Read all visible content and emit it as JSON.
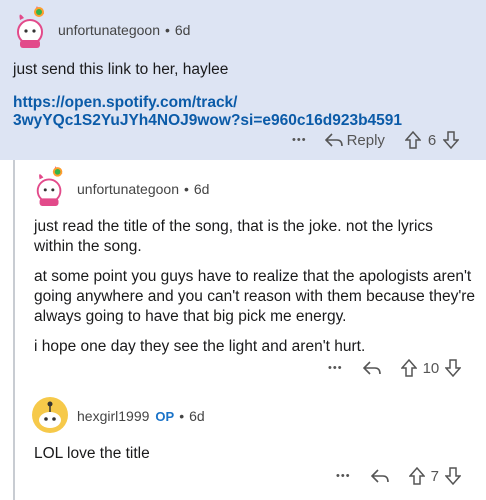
{
  "comments": [
    {
      "username": "unfortunategoon",
      "separator": "•",
      "age": "6d",
      "paragraphs": [
        "just send this link to her, haylee"
      ],
      "link_line1": "https://open.spotify.com/track/",
      "link_line2": "3wyYQc1S2YuJYh4NOJ9wow?si=e960c16d923b4591",
      "more": "•••",
      "reply_label": "Reply",
      "votes": "6"
    },
    {
      "username": "unfortunategoon",
      "separator": "•",
      "age": "6d",
      "paragraphs": [
        "just read the title of the song, that is the joke. not the lyrics within the song.",
        "at some point you guys have to realize that the apologists aren't going anywhere and you can't reason with them because they're always going to have that big pick me energy.",
        "i hope one day they see the light and aren't hurt."
      ],
      "more": "•••",
      "votes": "10"
    },
    {
      "username": "hexgirl1999",
      "op_badge": "OP",
      "separator": "•",
      "age": "6d",
      "paragraphs": [
        "LOL love the title"
      ],
      "more": "•••",
      "votes": "7"
    }
  ],
  "colors": {
    "highlight_bg": "#dde4f3",
    "link": "#0b5ba8",
    "op": "#1a73c8"
  }
}
